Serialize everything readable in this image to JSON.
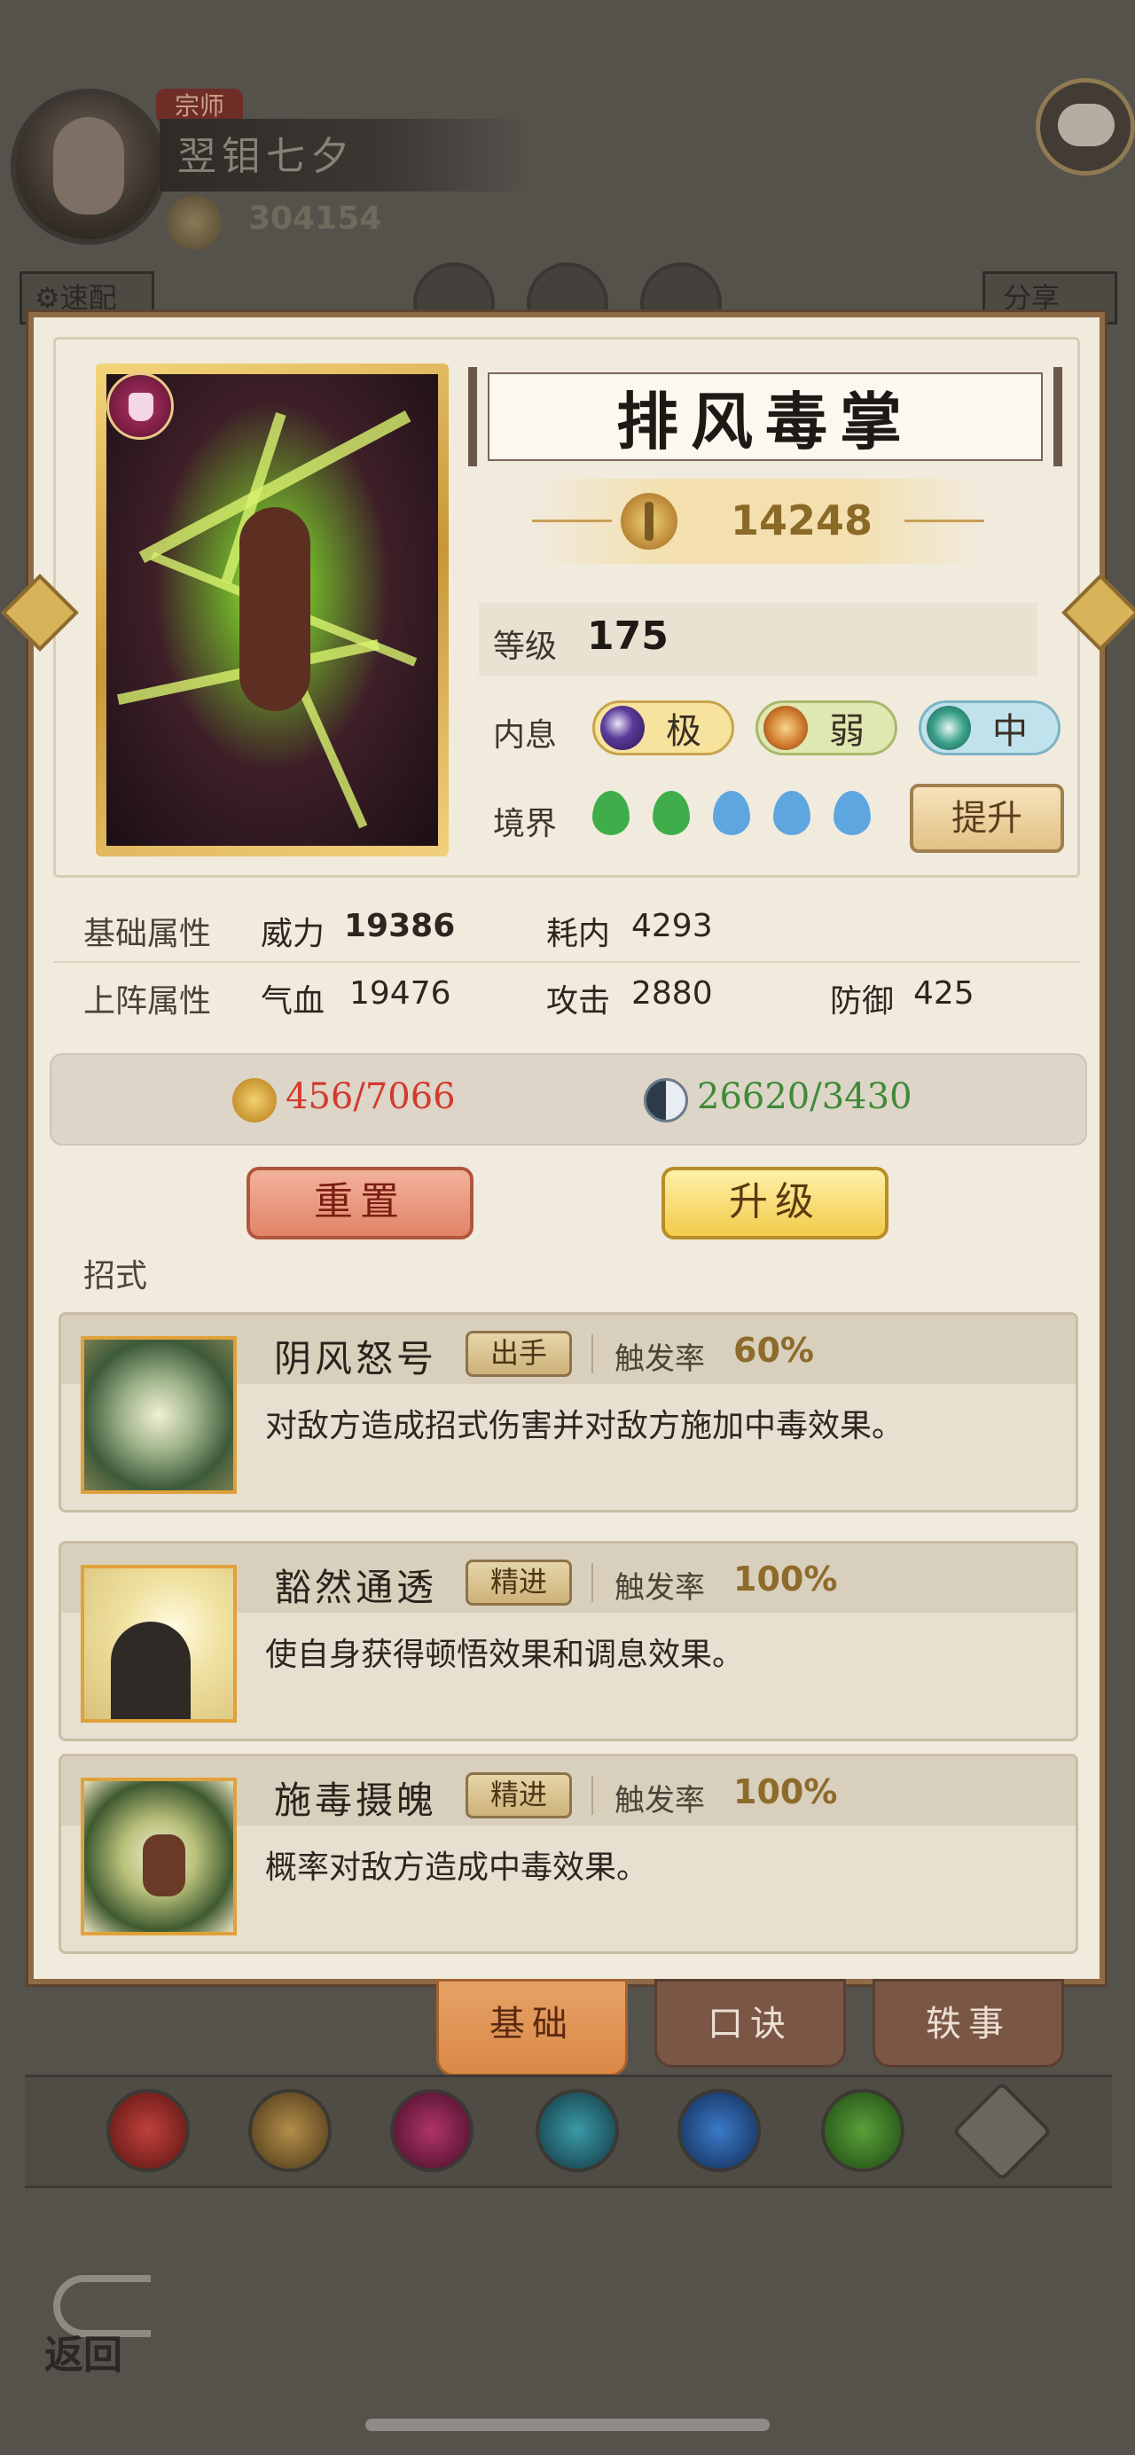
{
  "player": {
    "rank": "宗师",
    "name": "翌钼七夕",
    "power": "304154"
  },
  "top_buttons": {
    "quick_config": "⚙速配",
    "share": "分享"
  },
  "card": {
    "title": "排风毒掌",
    "power": "14248",
    "level_label": "等级",
    "level": "175",
    "inner_label": "内息",
    "inner_pills": [
      {
        "label": "极",
        "color": "#3e2a72"
      },
      {
        "label": "弱",
        "color": "#c8732a"
      },
      {
        "label": "中",
        "color": "#2f8a7a"
      }
    ],
    "realm_label": "境界",
    "realm_drops": [
      "green",
      "green",
      "blue",
      "blue",
      "blue"
    ],
    "raise_button": "提升"
  },
  "attributes": {
    "base_label": "基础属性",
    "base": [
      {
        "name": "威力",
        "value": "19386",
        "bold": true
      },
      {
        "name": "耗内",
        "value": "4293"
      }
    ],
    "battle_label": "上阵属性",
    "battle": [
      {
        "name": "气血",
        "value": "19476"
      },
      {
        "name": "攻击",
        "value": "2880"
      },
      {
        "name": "防御",
        "value": "425"
      }
    ]
  },
  "costs": {
    "coins": "456/7066",
    "essence": "26620/3430"
  },
  "actions": {
    "reset": "重置",
    "upgrade": "升级"
  },
  "moves_label": "招式",
  "skills": [
    {
      "name": "阴风怒号",
      "tag": "出手",
      "rate_label": "触发率",
      "rate": "60%",
      "desc": "对敌方造成招式伤害并对敌方施加中毒效果。"
    },
    {
      "name": "豁然通透",
      "tag": "精进",
      "rate_label": "触发率",
      "rate": "100%",
      "desc": "使自身获得顿悟效果和调息效果。"
    },
    {
      "name": "施毒摄魄",
      "tag": "精进",
      "rate_label": "触发率",
      "rate": "100%",
      "desc": "概率对敌方造成中毒效果。"
    }
  ],
  "tabs": [
    "基础",
    "口诀",
    "轶事"
  ],
  "back": "返回"
}
